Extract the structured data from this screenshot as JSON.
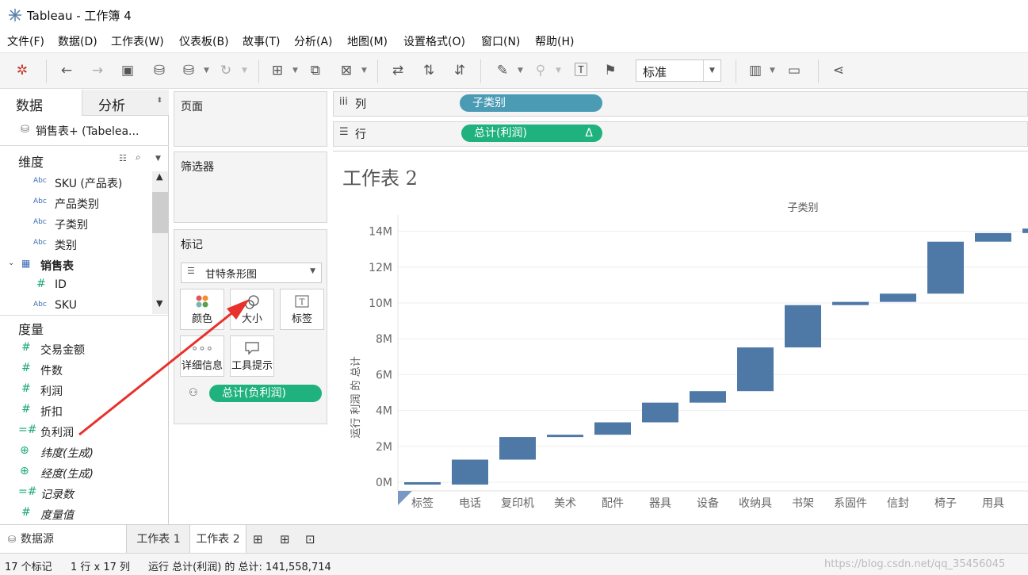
{
  "window": {
    "title": "Tableau - 工作簿 4"
  },
  "menu": [
    "文件(F)",
    "数据(D)",
    "工作表(W)",
    "仪表板(B)",
    "故事(T)",
    "分析(A)",
    "地图(M)",
    "设置格式(O)",
    "窗口(N)",
    "帮助(H)"
  ],
  "toolbar": {
    "fit_value": "标准"
  },
  "data_pane": {
    "tab_data": "数据",
    "tab_analytics": "分析",
    "datasource": "销售表+ (Tabelea...",
    "dimensions_header": "维度",
    "dimensions": [
      {
        "type": "Abc",
        "label": "SKU (产品表)"
      },
      {
        "type": "Abc",
        "label": "产品类别"
      },
      {
        "type": "Abc",
        "label": "子类别"
      },
      {
        "type": "Abc",
        "label": "类别"
      },
      {
        "type": "table",
        "label": "销售表"
      },
      {
        "type": "#",
        "label": "ID"
      },
      {
        "type": "Abc",
        "label": "SKU"
      }
    ],
    "measures_header": "度量",
    "measures": [
      {
        "type": "#",
        "label": "交易金额"
      },
      {
        "type": "#",
        "label": "件数"
      },
      {
        "type": "#",
        "label": "利润"
      },
      {
        "type": "#",
        "label": "折扣"
      },
      {
        "type": "=#",
        "label": "负利润"
      },
      {
        "type": "globe",
        "label": "纬度(生成)"
      },
      {
        "type": "globe",
        "label": "经度(生成)"
      },
      {
        "type": "=#",
        "label": "记录数"
      },
      {
        "type": "#",
        "label": "度量值"
      }
    ]
  },
  "cards": {
    "pages": "页面",
    "filters": "筛选器",
    "marks": "标记",
    "mark_type": "甘特条形图",
    "mark_buttons": [
      "颜色",
      "大小",
      "标签",
      "详细信息",
      "工具提示"
    ],
    "size_pill": "总计(负利润)"
  },
  "shelves": {
    "columns_label": "列",
    "columns_pill": "子类别",
    "rows_label": "行",
    "rows_pill": "总计(利润)",
    "rows_pill_delta": "Δ"
  },
  "view": {
    "sheet_title": "工作表 2",
    "header": "子类别"
  },
  "chart_data": {
    "type": "bar",
    "subtype": "waterfall-gantt",
    "xlabel": "子类别",
    "ylabel": "运行 利润 的 总计",
    "ylim": [
      -1.2,
      14.3
    ],
    "yticks": [
      0,
      2,
      4,
      6,
      8,
      10,
      12,
      14
    ],
    "ytick_labels": [
      "0M",
      "2M",
      "4M",
      "6M",
      "8M",
      "10M",
      "12M",
      "14M"
    ],
    "categories": [
      "标签",
      "电话",
      "复印机",
      "美术",
      "配件",
      "器具",
      "设备",
      "收纳具",
      "书架",
      "系固件",
      "信封",
      "椅子",
      "用具"
    ],
    "series": [
      {
        "start": [
          0.0,
          -0.13,
          1.26,
          2.52,
          2.65,
          3.34,
          4.44,
          5.08,
          7.52,
          9.88,
          10.06,
          10.52,
          13.42,
          13.9
        ],
        "end": [
          -0.13,
          1.26,
          2.52,
          2.65,
          3.34,
          4.44,
          5.08,
          7.52,
          9.88,
          10.06,
          10.52,
          13.42,
          13.9,
          14.15
        ]
      }
    ],
    "bar_color": "#4e79a7",
    "grid": true
  },
  "tabs": {
    "datasource": "数据源",
    "sheet1": "工作表 1",
    "sheet2": "工作表 2"
  },
  "status": {
    "marks": "17 个标记",
    "dims": "1 行 x 17 列",
    "sum": "运行 总计(利润) 的 总计: 141,558,714"
  },
  "watermark": "https://blog.csdn.net/qq_35456045"
}
